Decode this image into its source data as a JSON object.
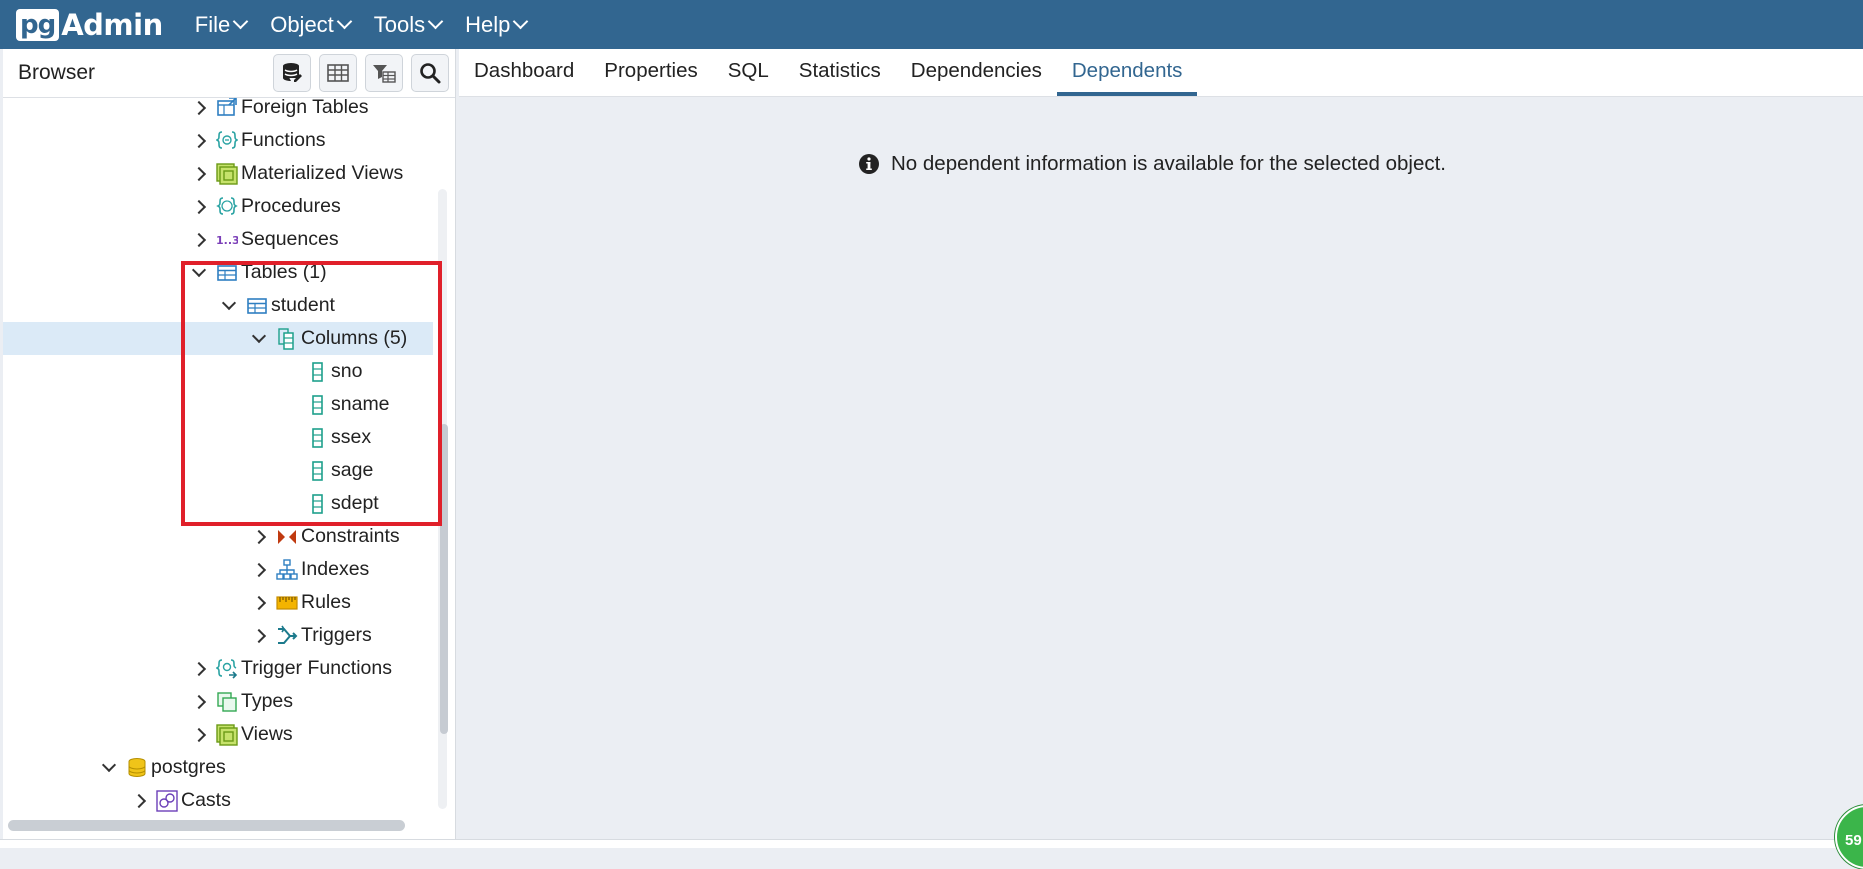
{
  "app": {
    "logo_pg": "pg",
    "logo_admin": "Admin"
  },
  "menu": [
    {
      "label": "File"
    },
    {
      "label": "Object"
    },
    {
      "label": "Tools"
    },
    {
      "label": "Help"
    }
  ],
  "browser": {
    "title": "Browser",
    "toolbar": [
      "query-tool-icon",
      "view-data-icon",
      "filtered-rows-icon",
      "search-objects-icon"
    ]
  },
  "tree": [
    {
      "label": "Foreign Tables",
      "icon": "foreign-table-icon",
      "state": "collapsed"
    },
    {
      "label": "Functions",
      "icon": "function-icon",
      "state": "collapsed"
    },
    {
      "label": "Materialized Views",
      "icon": "materialized-view-icon",
      "state": "collapsed"
    },
    {
      "label": "Procedures",
      "icon": "procedure-icon",
      "state": "collapsed"
    },
    {
      "label": "Sequences",
      "icon": "sequence-icon",
      "state": "collapsed"
    },
    {
      "label": "Tables (1)",
      "icon": "table-icon",
      "state": "expanded"
    },
    {
      "label": "student",
      "icon": "table-icon",
      "state": "expanded"
    },
    {
      "label": "Columns (5)",
      "icon": "columns-icon",
      "state": "expanded",
      "selected": true
    },
    {
      "label": "sno",
      "icon": "column-icon",
      "state": "leaf"
    },
    {
      "label": "sname",
      "icon": "column-icon",
      "state": "leaf"
    },
    {
      "label": "ssex",
      "icon": "column-icon",
      "state": "leaf"
    },
    {
      "label": "sage",
      "icon": "column-icon",
      "state": "leaf"
    },
    {
      "label": "sdept",
      "icon": "column-icon",
      "state": "leaf"
    },
    {
      "label": "Constraints",
      "icon": "constraint-icon",
      "state": "collapsed"
    },
    {
      "label": "Indexes",
      "icon": "index-icon",
      "state": "collapsed"
    },
    {
      "label": "Rules",
      "icon": "rule-icon",
      "state": "collapsed"
    },
    {
      "label": "Triggers",
      "icon": "trigger-icon",
      "state": "collapsed"
    },
    {
      "label": "Trigger Functions",
      "icon": "trigger-function-icon",
      "state": "collapsed"
    },
    {
      "label": "Types",
      "icon": "type-icon",
      "state": "collapsed"
    },
    {
      "label": "Views",
      "icon": "view-icon",
      "state": "collapsed"
    },
    {
      "label": "postgres",
      "icon": "database-icon",
      "state": "expanded"
    },
    {
      "label": "Casts",
      "icon": "cast-icon",
      "state": "collapsed"
    }
  ],
  "tabs": [
    {
      "label": "Dashboard"
    },
    {
      "label": "Properties"
    },
    {
      "label": "SQL"
    },
    {
      "label": "Statistics"
    },
    {
      "label": "Dependencies"
    },
    {
      "label": "Dependents",
      "active": true
    }
  ],
  "content": {
    "message": "No dependent information is available for the selected object."
  },
  "badge": {
    "text": "59"
  },
  "colors": {
    "navbar": "#326690",
    "accent": "#326690",
    "selection": "#dbeaf7",
    "highlight_box": "#e0202a"
  }
}
